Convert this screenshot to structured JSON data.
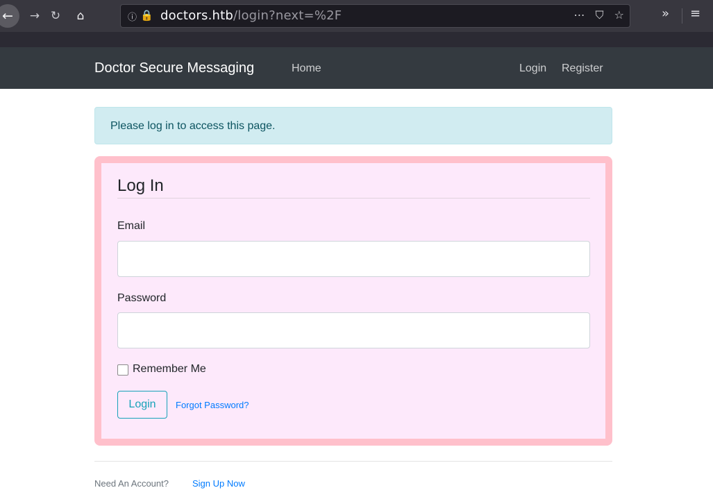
{
  "browser": {
    "back_icon": "←",
    "forward_icon": "→",
    "reload_icon": "↻",
    "home_icon": "⌂",
    "info_icon": "ⓘ",
    "insecure_icon": "🔒",
    "url_host": "doctors.htb",
    "url_path": "/login?next=%2F",
    "more_icon": "⋯",
    "pocket_icon": "⛉",
    "star_icon": "☆",
    "overflow_icon": "»",
    "menu_icon": "≡"
  },
  "navbar": {
    "brand": "Doctor Secure Messaging",
    "home": "Home",
    "login": "Login",
    "register": "Register"
  },
  "alert": {
    "message": "Please log in to access this page."
  },
  "form": {
    "legend": "Log In",
    "email_label": "Email",
    "email_value": "",
    "password_label": "Password",
    "password_value": "",
    "remember_label": "Remember Me",
    "remember_checked": false,
    "submit_label": "Login",
    "forgot_label": "Forgot Password?"
  },
  "footer": {
    "need_account": "Need An Account?",
    "signup": "Sign Up Now"
  },
  "colors": {
    "navbar_bg": "#343a40",
    "alert_bg": "#d1ecf1",
    "card_bg": "#fde9fb",
    "card_border": "#ffc0cb",
    "link": "#007bff",
    "button_outline": "#17a2b8"
  }
}
